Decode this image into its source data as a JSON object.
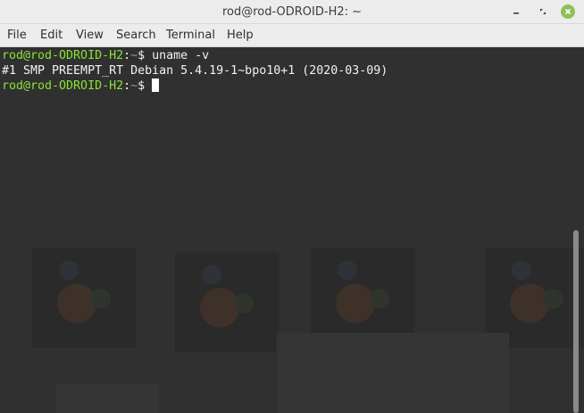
{
  "window": {
    "title": "rod@rod-ODROID-H2: ~",
    "buttons": {
      "minimize_icon": "minimize-icon",
      "maximize_icon": "maximize-icon",
      "close_icon": "close-icon",
      "close_color": "#8fbf5a"
    }
  },
  "menubar": {
    "items": [
      "File",
      "Edit",
      "View",
      "Search",
      "Terminal",
      "Help"
    ]
  },
  "terminal": {
    "colors": {
      "background": "#303030",
      "prompt_user": "#8ae234",
      "prompt_path": "#729fcf",
      "text": "#f2f2f2"
    },
    "lines": [
      {
        "prompt_user": "rod@rod-ODROID-H2",
        "prompt_sep": ":",
        "prompt_path": "~",
        "prompt_symbol": "$ ",
        "command": "uname -v"
      },
      {
        "output": "#1 SMP PREEMPT_RT Debian 5.4.19-1~bpo10+1 (2020-03-09)"
      },
      {
        "prompt_user": "rod@rod-ODROID-H2",
        "prompt_sep": ":",
        "prompt_path": "~",
        "prompt_symbol": "$ ",
        "command": ""
      }
    ]
  }
}
